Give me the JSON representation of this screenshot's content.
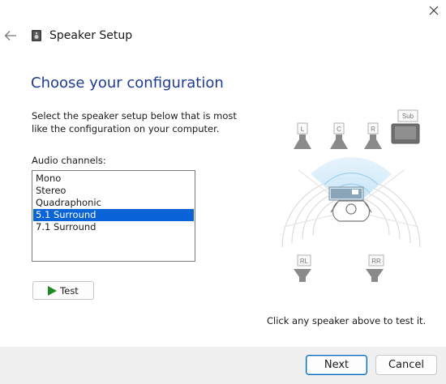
{
  "window": {
    "title": "Speaker Setup"
  },
  "main": {
    "heading": "Choose your configuration",
    "description": "Select the speaker setup below that is most like the configuration on your computer.",
    "channels_label": "Audio channels:",
    "channels": [
      {
        "label": "Mono",
        "selected": false
      },
      {
        "label": "Stereo",
        "selected": false
      },
      {
        "label": "Quadraphonic",
        "selected": false
      },
      {
        "label": "5.1 Surround",
        "selected": true
      },
      {
        "label": "7.1 Surround",
        "selected": false
      }
    ],
    "test_label": "Test",
    "hint": "Click any speaker above to test it."
  },
  "speakers": {
    "left": "L",
    "center": "C",
    "right": "R",
    "sub": "Sub",
    "rear_left": "RL",
    "rear_right": "RR"
  },
  "footer": {
    "next_label": "Next",
    "cancel_label": "Cancel"
  },
  "colors": {
    "heading": "#1f3a93",
    "selection": "#0a64d8",
    "play": "#1f8a1f",
    "footer_bg": "#f0f0f0"
  }
}
